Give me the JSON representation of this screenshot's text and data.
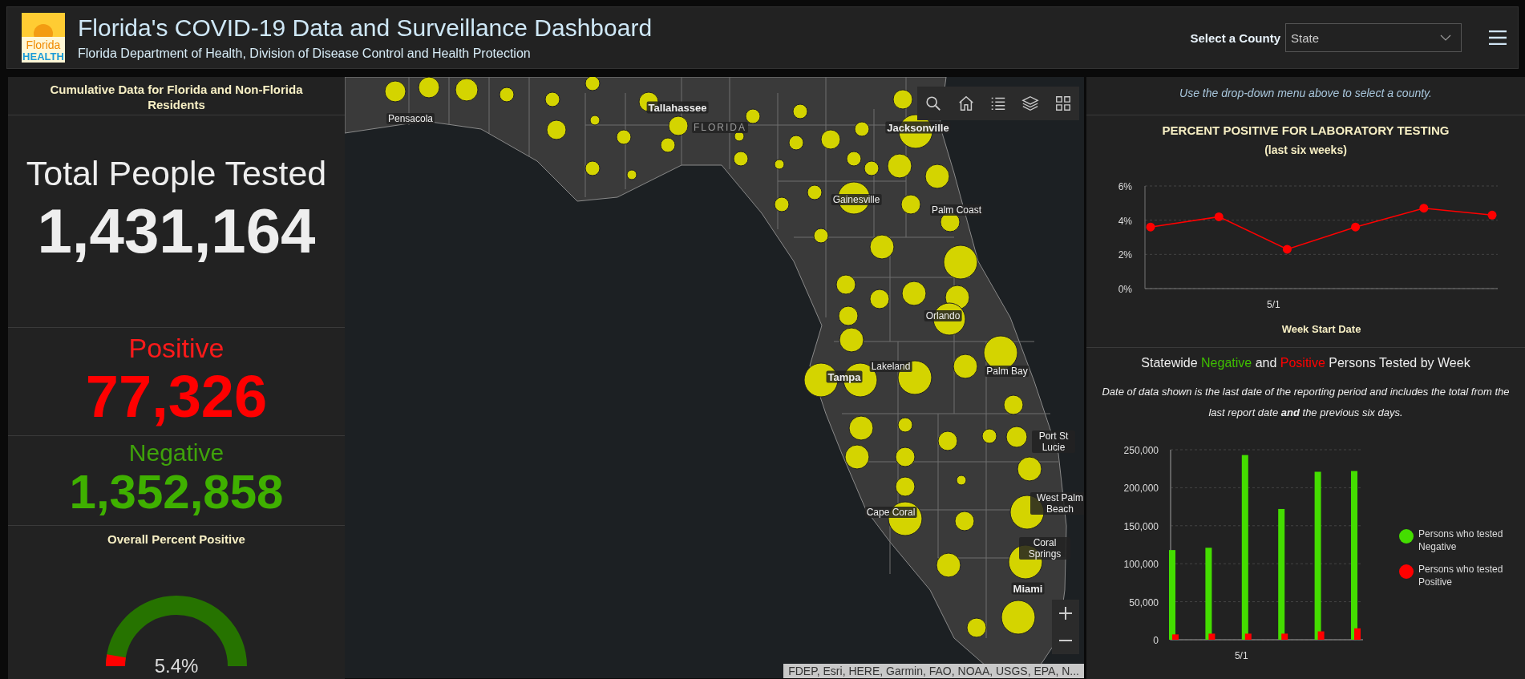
{
  "header": {
    "logo": {
      "line_1": "Florida",
      "line_2": "HEALTH"
    },
    "title": "Florida's COVID-19 Data and Surveillance Dashboard",
    "subtitle": "Florida Department of Health, Division of Disease Control and Health Protection",
    "county_select": {
      "label": "Select a County",
      "value": "State"
    }
  },
  "summary": {
    "heading": "Cumulative Data for Florida and Non-Florida Residents",
    "total": {
      "label": "Total People Tested",
      "value": "1,431,164"
    },
    "positive": {
      "label": "Positive",
      "value": "77,326"
    },
    "negative": {
      "label": "Negative",
      "value": "1,352,858"
    },
    "overall": {
      "label": "Overall Percent Positive",
      "level": 0.054,
      "reading": "5.4%"
    }
  },
  "map": {
    "labels": [
      {
        "text": "Pensacola",
        "kind": "city"
      },
      {
        "text": "Tallahassee",
        "kind": "major"
      },
      {
        "text": "FLORIDA",
        "kind": "state"
      },
      {
        "text": "Jacksonville",
        "kind": "major"
      },
      {
        "text": "Gainesville",
        "kind": "city"
      },
      {
        "text": "Palm Coast",
        "kind": "city"
      },
      {
        "text": "Orlando",
        "kind": "city"
      },
      {
        "text": "Lakeland",
        "kind": "city"
      },
      {
        "text": "Tampa",
        "kind": "major"
      },
      {
        "text": "Palm Bay",
        "kind": "city"
      },
      {
        "text": "Port St Lucie",
        "kind": "city"
      },
      {
        "text": "West Palm Beach",
        "kind": "city"
      },
      {
        "text": "Cape Coral",
        "kind": "city"
      },
      {
        "text": "Coral Springs",
        "kind": "city"
      },
      {
        "text": "Miami",
        "kind": "major"
      }
    ],
    "attribution": "FDEP, Esri, HERE, Garmin, FAO, NOAA, USGS, EPA, N..."
  },
  "right_panel": {
    "note": "Use the drop-down menu above to select a county.",
    "percent_chart": {
      "subtitle": "(last six weeks)",
      "x_tick_label": "5/1",
      "chart_data": {
        "type": "line",
        "title": "PERCENT POSITIVE FOR LABORATORY TESTING",
        "xlabel": "Week Start Date",
        "grid": true,
        "ylim": [
          0,
          6
        ],
        "yticks": [
          {
            "value": 0,
            "label": "0%"
          },
          {
            "value": 2,
            "label": "2%"
          },
          {
            "value": 4,
            "label": "4%"
          },
          {
            "value": 6,
            "label": "6%"
          }
        ],
        "series": [
          {
            "color": "#ff0000",
            "marker": true,
            "values": [
              3.6,
              4.2,
              2.3,
              3.6,
              4.7,
              4.3
            ]
          }
        ]
      }
    },
    "weekly_chart": {
      "title_parts": [
        {
          "text": "Statewide"
        },
        {
          "text": "Negative",
          "color": "#3fbf00"
        },
        {
          "text": "and"
        },
        {
          "text": "Positive",
          "color": "#ff0000"
        },
        {
          "text": "Persons Tested by Week"
        }
      ],
      "note": "Date of data shown is the last date of the reporting period and includes the total from the last report date **and** the previous six days.",
      "x_tick_label": "5/1",
      "chart_data": {
        "type": "bar",
        "grid": true,
        "legend": "right",
        "ylim": [
          0,
          250000
        ],
        "yticks": [
          {
            "value": 0,
            "label": "0"
          },
          {
            "value": 50000,
            "label": "50,000"
          },
          {
            "value": 100000,
            "label": "100,000"
          },
          {
            "value": 150000,
            "label": "150,000"
          },
          {
            "value": 200000,
            "label": "200,000"
          },
          {
            "value": 250000,
            "label": "250,000"
          }
        ],
        "series": [
          {
            "name": "Persons who tested Negative",
            "color": "#44dd00",
            "values": [
              118000,
              121000,
              243000,
              172000,
              221000,
              222000
            ]
          },
          {
            "name": "Persons who tested Positive",
            "color": "#ff0000",
            "values": [
              7000,
              8000,
              8000,
              8000,
              11000,
              15000
            ]
          }
        ]
      }
    }
  }
}
